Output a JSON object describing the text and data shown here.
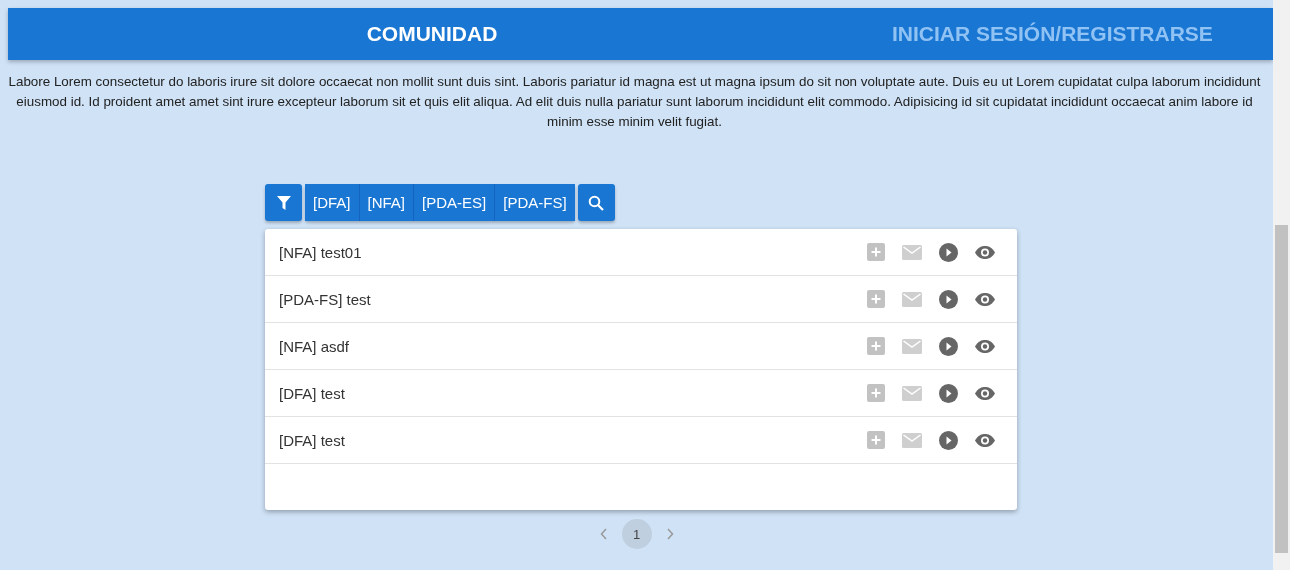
{
  "header": {
    "title": "COMUNIDAD",
    "login_link": "INICIAR SESIÓN/REGISTRARSE"
  },
  "intro": "Labore Lorem consectetur do laboris irure sit dolore occaecat non mollit sunt duis sint. Laboris pariatur id magna est ut magna ipsum do sit non voluptate aute. Duis eu ut Lorem cupidatat culpa laborum incididunt eiusmod id. Id proident amet amet sint irure excepteur laborum sit et quis elit aliqua. Ad elit duis nulla pariatur sunt laborum incididunt elit commodo. Adipisicing id sit cupidatat incididunt occaecat anim labore id minim esse minim velit fugiat.",
  "filters": [
    "[DFA]",
    "[NFA]",
    "[PDA-ES]",
    "[PDA-FS]"
  ],
  "rows": [
    {
      "title": "[NFA] test01"
    },
    {
      "title": "[PDA-FS] test"
    },
    {
      "title": "[NFA] asdf"
    },
    {
      "title": "[DFA] test"
    },
    {
      "title": "[DFA] test"
    }
  ],
  "pagination": {
    "pages": [
      {
        "label": "1",
        "selected": true
      }
    ]
  }
}
